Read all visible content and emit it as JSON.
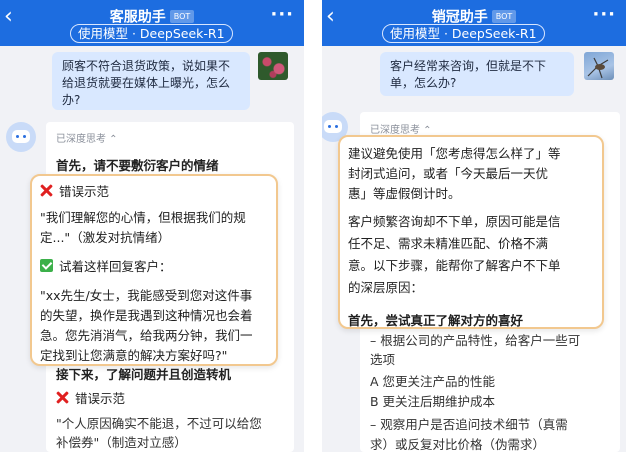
{
  "left_panel": {
    "header": {
      "title": "客服助手",
      "bot_badge": "BOT",
      "model_badge": "使用模型 · DeepSeek-R1"
    },
    "user_message": [
      "顾客不符合退货政策，说如果不",
      "给退货就要在媒体上曝光，怎么",
      "办?"
    ],
    "think_label": "已深度思考 ⌃",
    "answer_heading": "首先，请不要敷衍客户的情绪",
    "popup": {
      "wrong_label": "错误示范",
      "wrong_text": [
        "\"我们理解您的心情，但根据我们的规",
        "定...\"（激发对抗情绪）"
      ],
      "right_label": "试着这样回复客户：",
      "right_text": [
        "\"xx先生/女士，我能感受到您对这件事",
        "的失望，换作是我遇到这种情况也会着",
        "急。您先消消气，给我两分钟，我们一",
        "定找到让您满意的解决方案好吗?\""
      ]
    },
    "answer_heading2": "接下来，了解问题并且创造转机",
    "wrong_label2": "错误示范",
    "answer_tail": [
      "\"个人原因确实不能退，不过可以给您",
      "补偿券\"（制造对立感）"
    ]
  },
  "right_panel": {
    "header": {
      "title": "销冠助手",
      "bot_badge": "BOT",
      "model_badge": "使用模型 · DeepSeek-R1"
    },
    "user_message": [
      "客户经常来咨询，但就是不下",
      "单，怎么办?"
    ],
    "think_label": "已深度思考 ⌃",
    "popup": {
      "para1": [
        "建议避免使用「您考虑得怎么样了」等",
        "封闭式追问，或者「今天最后一天优",
        "惠」等虚假倒计时。"
      ],
      "para2": [
        "客户频繁咨询却不下单，原因可能是信",
        "任不足、需求未精准匹配、价格不满",
        "意。以下步骤，能帮你了解客户不下单",
        "的深层原因："
      ],
      "heading": "首先，尝试真正了解对方的喜好"
    },
    "answer_lines": [
      "– 根据公司的产品特性，给客户一些可",
      "选项",
      "A 您更关注产品的性能",
      "B 更关注后期维护成本",
      "– 观察用户是否追问技术细节（真需",
      "求）或反复对比价格（伪需求）"
    ]
  },
  "icons": {
    "back": "chevron-left-icon",
    "more": "more-icon",
    "avatar": "bot-avatar-icon"
  },
  "colors": {
    "header_blue": "#1d6de0",
    "user_bubble": "#d9e8ff",
    "popup_border": "#f2c88f",
    "wrong_red": "#e02020",
    "right_green": "#3cb04a"
  }
}
